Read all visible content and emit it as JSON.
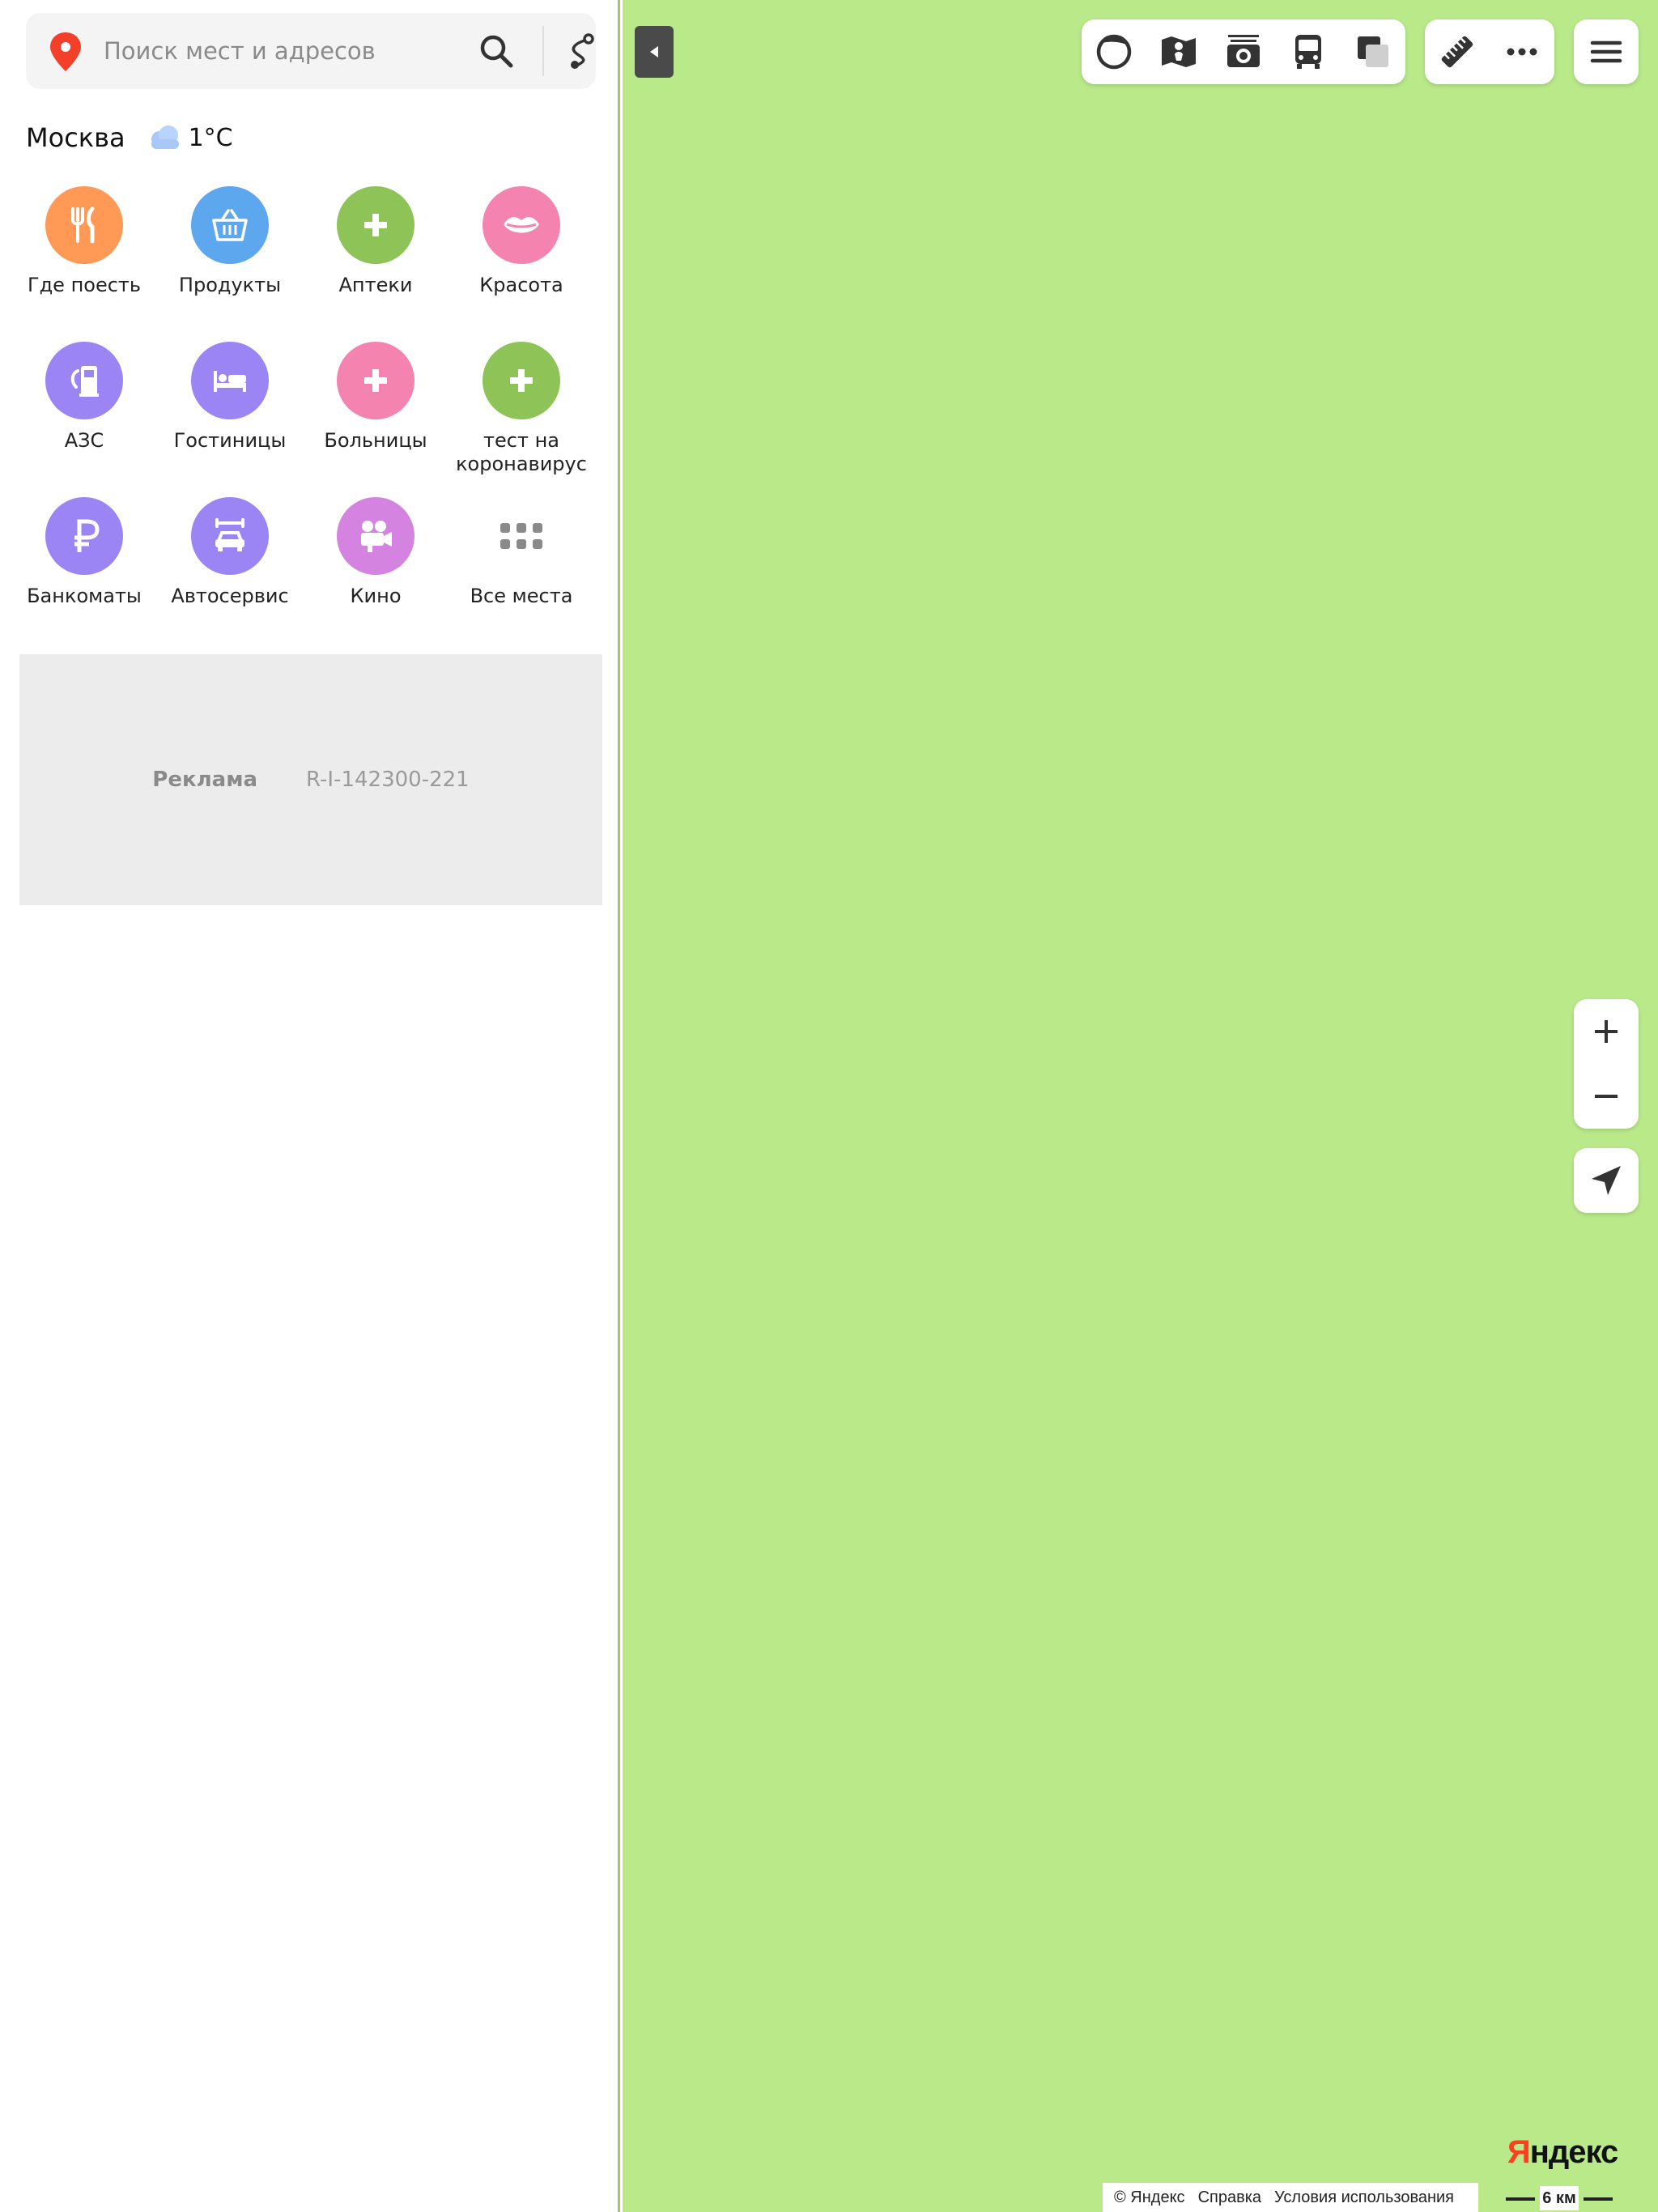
{
  "search": {
    "placeholder": "Поиск мест и адресов"
  },
  "city": {
    "name": "Москва",
    "temperature": "1°C"
  },
  "categories": [
    {
      "label": "Где поесть",
      "color": "#ff9955",
      "icon": "fork-knife-icon"
    },
    {
      "label": "Продукты",
      "color": "#5da7ee",
      "icon": "basket-icon"
    },
    {
      "label": "Аптеки",
      "color": "#8ec357",
      "icon": "plus-icon"
    },
    {
      "label": "Красота",
      "color": "#f483b0",
      "icon": "lips-icon"
    },
    {
      "label": "АЗС",
      "color": "#9b85f4",
      "icon": "fuel-icon"
    },
    {
      "label": "Гостиницы",
      "color": "#9b85f4",
      "icon": "bed-icon"
    },
    {
      "label": "Больницы",
      "color": "#f483b0",
      "icon": "plus-icon"
    },
    {
      "label": "тест на коронавирус",
      "color": "#8ec357",
      "icon": "plus-icon"
    },
    {
      "label": "Банкоматы",
      "color": "#9b85f4",
      "icon": "ruble-icon"
    },
    {
      "label": "Автосервис",
      "color": "#9b85f4",
      "icon": "car-service-icon"
    },
    {
      "label": "Кино",
      "color": "#d583e0",
      "icon": "film-camera-icon"
    },
    {
      "label": "Все места",
      "color": "",
      "icon": "grid-dots-icon"
    }
  ],
  "ad": {
    "label": "Реклама",
    "id": "R-I-142300-221"
  },
  "map": {
    "background_color": "#bae98a",
    "footer": {
      "copyright": "© Яндекс",
      "help": "Справка",
      "terms": "Условия использования"
    },
    "scale": "6 км",
    "logo_first": "Я",
    "logo_rest": "ндекс"
  }
}
